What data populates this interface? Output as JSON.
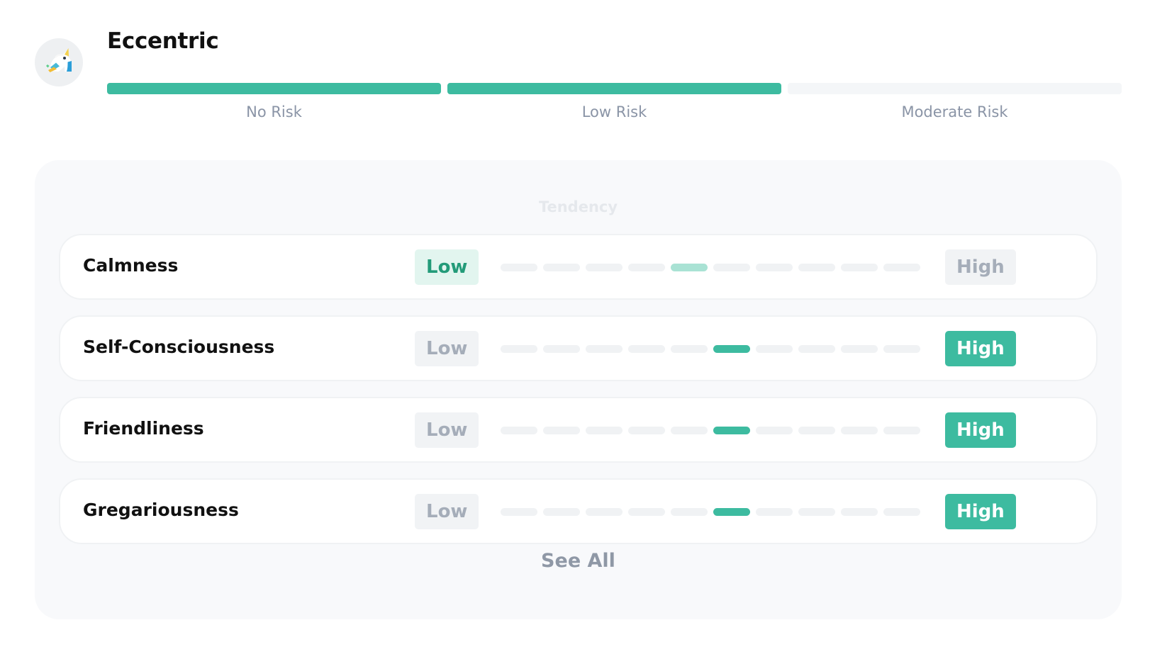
{
  "profile": {
    "avatar_icon": "unicorn-icon",
    "title": "Eccentric"
  },
  "risk_scale": {
    "segments": [
      {
        "label": "No Risk",
        "filled": true
      },
      {
        "label": "Low Risk",
        "filled": true
      },
      {
        "label": "Moderate Risk",
        "filled": false
      }
    ],
    "fill_color": "#3dbba0",
    "empty_color": "#f4f6f8"
  },
  "tendency": {
    "title": "Tendency",
    "traits": [
      {
        "name": "Calmness",
        "low_label": "Low",
        "high_label": "High",
        "selected_pole": "low",
        "scale_steps": 10,
        "selected_step": 5
      },
      {
        "name": "Self-Consciousness",
        "low_label": "Low",
        "high_label": "High",
        "selected_pole": "high",
        "scale_steps": 10,
        "selected_step": 6
      },
      {
        "name": "Friendliness",
        "low_label": "Low",
        "high_label": "High",
        "selected_pole": "high",
        "scale_steps": 10,
        "selected_step": 6
      },
      {
        "name": "Gregariousness",
        "low_label": "Low",
        "high_label": "High",
        "selected_pole": "high",
        "scale_steps": 10,
        "selected_step": 6
      }
    ],
    "see_all_label": "See All"
  },
  "colors": {
    "accent": "#3dbba0",
    "accent_light": "#a9e2d4",
    "low_active_background": "#e2f5ef",
    "low_active_text": "#239b79",
    "inactive_background": "#f1f3f5",
    "inactive_text": "#a5adb9"
  }
}
